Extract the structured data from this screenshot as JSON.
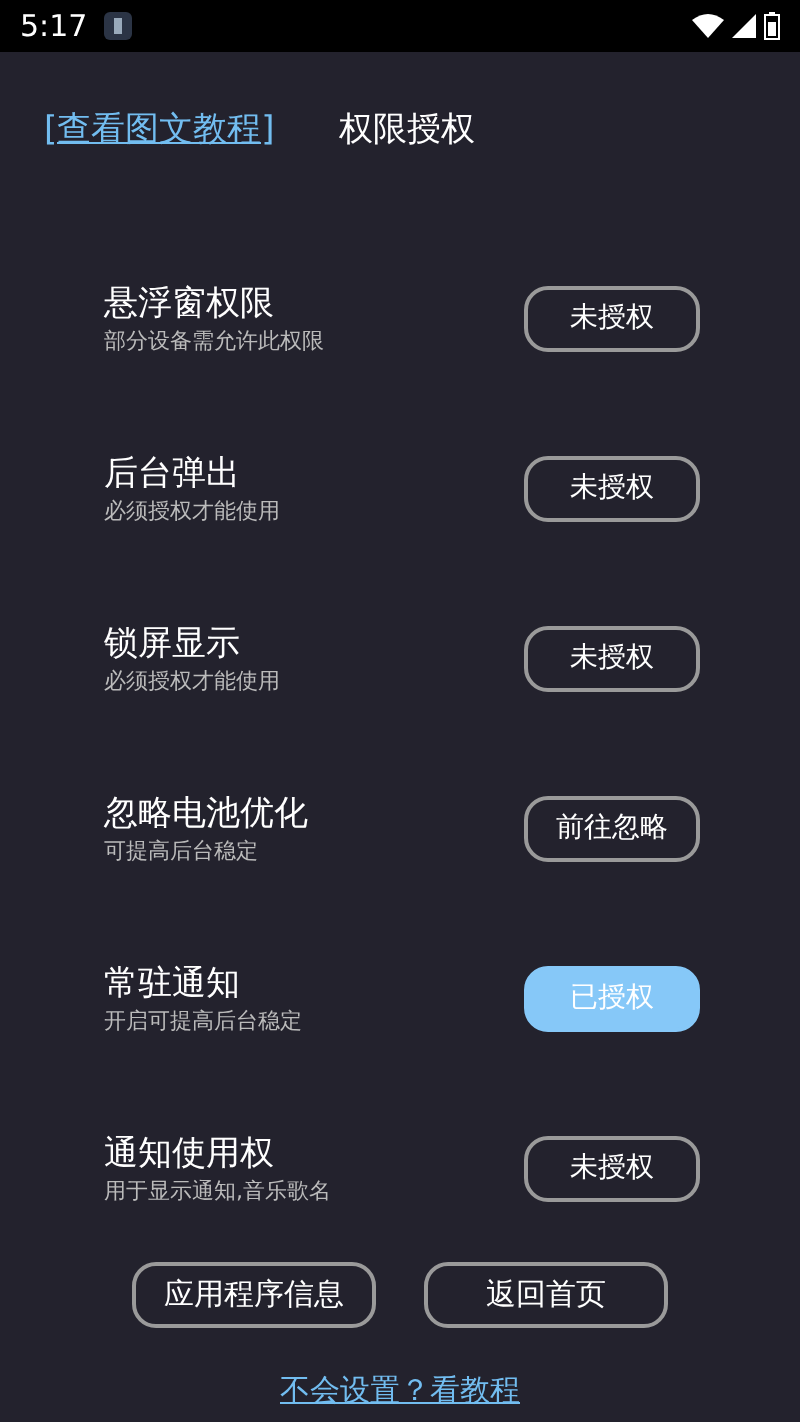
{
  "status_bar": {
    "time": "5:17"
  },
  "header": {
    "tutorial_link": "[查看图文教程]",
    "title": "权限授权"
  },
  "permissions": [
    {
      "title": "悬浮窗权限",
      "subtitle": "部分设备需允许此权限",
      "button": "未授权",
      "granted": false
    },
    {
      "title": "后台弹出",
      "subtitle": "必须授权才能使用",
      "button": "未授权",
      "granted": false
    },
    {
      "title": "锁屏显示",
      "subtitle": "必须授权才能使用",
      "button": "未授权",
      "granted": false
    },
    {
      "title": "忽略电池优化",
      "subtitle": "可提高后台稳定",
      "button": "前往忽略",
      "granted": false
    },
    {
      "title": "常驻通知",
      "subtitle": "开启可提高后台稳定",
      "button": "已授权",
      "granted": true
    },
    {
      "title": "通知使用权",
      "subtitle": "用于显示通知,音乐歌名",
      "button": "未授权",
      "granted": false
    }
  ],
  "actions": [
    "应用程序信息",
    "返回首页"
  ],
  "help_link": "不会设置？看教程"
}
